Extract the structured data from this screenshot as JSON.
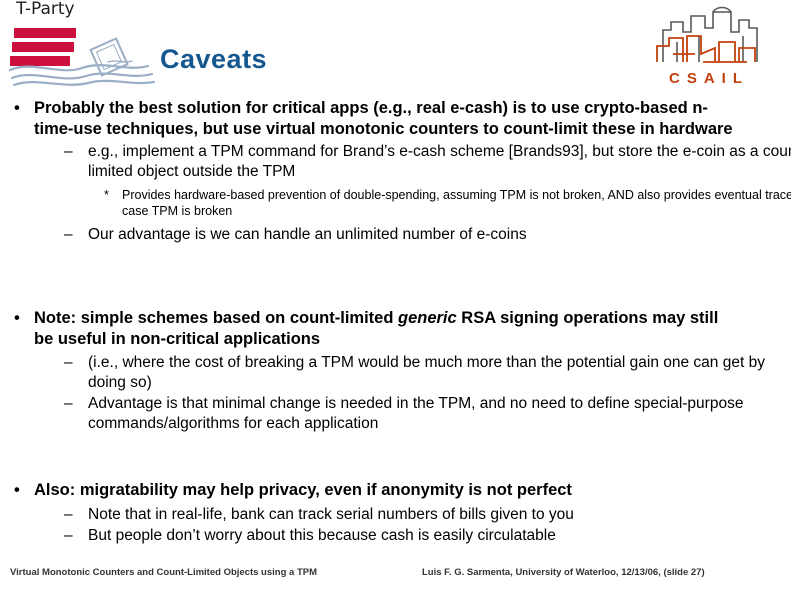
{
  "header": {
    "logo_wordmark": "T-Party",
    "title": "Caveats",
    "title_color": "#15578f",
    "flag_color": "#cc0f3c",
    "wave_color": "#9aaec6",
    "csail_wordmark": "CSAIL",
    "csail_color": "#c2410c",
    "csail_building_gray": "#595959"
  },
  "body": {
    "bullets": [
      {
        "level": 1,
        "marker": "•",
        "text": "Probably the best solution for critical apps (e.g., real e-cash) is to use crypto-based n-time-use techniques, but use virtual monotonic counters to count-limit these in hardware"
      },
      {
        "level": 2,
        "marker": "–",
        "text": "e.g., implement a TPM command for Brand’s e-cash scheme [Brands93], but store the e-coin as a count-limited object outside the TPM"
      },
      {
        "level": 3,
        "marker": "*",
        "text": "Provides hardware-based prevention of double-spending, assuming TPM is not broken, AND also provides eventual traceability, in case TPM is broken"
      },
      {
        "level": 2,
        "marker": "–",
        "text": "Our advantage is we can handle an unlimited number of e-coins"
      },
      {
        "level": 1,
        "marker": "•",
        "text_before": "Note: simple schemes based on count-limited ",
        "text_italic": "generic",
        "text_after": " RSA signing operations may still be useful in non-critical applications"
      },
      {
        "level": 2,
        "marker": "–",
        "text": "(i.e., where the cost of breaking a TPM would be much more than the potential gain one can get by doing so)"
      },
      {
        "level": 2,
        "marker": "–",
        "text": "Advantage is that minimal change is needed in the TPM, and no need to define special-purpose commands/algorithms for each application"
      },
      {
        "level": 1,
        "marker": "•",
        "text": "Also: migratability may help privacy, even if anonymity is not perfect"
      },
      {
        "level": 2,
        "marker": "–",
        "text": "Note that in real-life, bank can track serial numbers of bills given to you"
      },
      {
        "level": 2,
        "marker": "–",
        "text": "But people don’t worry about this because cash is easily circulatable"
      }
    ]
  },
  "footer": {
    "left": "Virtual Monotonic Counters and Count-Limited Objects using a TPM",
    "right": "Luis F. G. Sarmenta, University of Waterloo, 12/13/06, (slide 27)"
  }
}
